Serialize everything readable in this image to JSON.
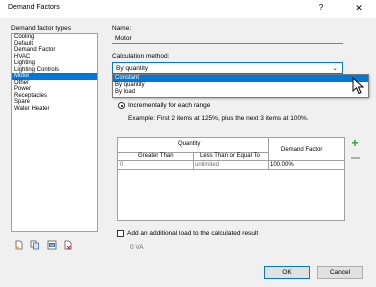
{
  "window": {
    "title": "Demand Factors",
    "help": "?",
    "close": "✕"
  },
  "left": {
    "list_label": "Demand factor types",
    "items": [
      "Cooling",
      "Default",
      "Demand Factor",
      "HVAC",
      "Lighting",
      "Lighting Controls",
      "Motor",
      "Other",
      "Power",
      "Receptacles",
      "Spare",
      "Water Heater"
    ],
    "selected_index": 6,
    "toolbar": [
      "new-type-icon",
      "duplicate-type-icon",
      "rename-type-icon",
      "delete-type-icon"
    ]
  },
  "right": {
    "name_label": "Name:",
    "name_value": "Motor",
    "calc_label": "Calculation method:",
    "calc_value": "By quantity",
    "calc_options": [
      "Constant",
      "By quantity",
      "By load"
    ],
    "calc_highlighted_index": 0,
    "radio_label": "Incrementally for each range",
    "example": "Example: First 2 items at 125%, plus the next 3 items at 100%.",
    "table": {
      "group_header": "Quantity",
      "col1": "Greater Than",
      "col2": "Less Than or Equal To",
      "col3": "Demand Factor",
      "rows": [
        {
          "greater": "0",
          "less": "unlimited",
          "factor": "100.00%"
        }
      ]
    },
    "checkbox_label": "Add an additional load to the calculated result",
    "additional_load": "0 VA"
  },
  "buttons": {
    "ok": "OK",
    "cancel": "Cancel"
  },
  "colors": {
    "accent": "#0078d7",
    "add": "#2aa02a"
  }
}
